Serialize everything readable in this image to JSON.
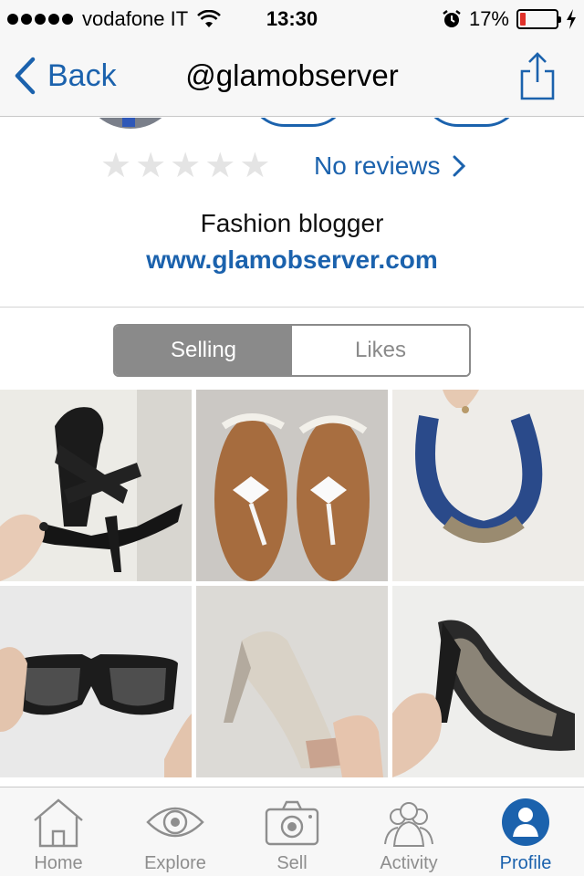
{
  "status_bar": {
    "carrier": "vodafone IT",
    "time": "13:30",
    "battery": "17%",
    "battery_level": 0.17,
    "signal_bars": 5
  },
  "nav": {
    "back_label": "Back",
    "title": "@glamobserver",
    "share_icon": "share-icon"
  },
  "profile": {
    "rating_stars": 0,
    "rating_max": 5,
    "reviews_label": "No reviews",
    "bio": "Fashion blogger",
    "website": "www.glamobserver.com"
  },
  "segments": {
    "selected": "Selling",
    "items": [
      "Selling",
      "Likes"
    ]
  },
  "listings": [
    {
      "item": "black strappy high-heel sandal"
    },
    {
      "item": "white bow flat sandals"
    },
    {
      "item": "blue braided necklace"
    },
    {
      "item": "black sunglasses"
    },
    {
      "item": "silver peep-toe stiletto pump"
    },
    {
      "item": "black patterned peep-toe platform heel"
    }
  ],
  "tab_bar": {
    "selected": "Profile",
    "items": [
      {
        "label": "Home",
        "icon": "home-icon"
      },
      {
        "label": "Explore",
        "icon": "eye-icon"
      },
      {
        "label": "Sell",
        "icon": "camera-icon"
      },
      {
        "label": "Activity",
        "icon": "people-icon"
      },
      {
        "label": "Profile",
        "icon": "person-icon"
      }
    ]
  },
  "colors": {
    "accent": "#1b62ad",
    "segment_active": "#8a8a8a",
    "battery_low": "#e0312a"
  }
}
